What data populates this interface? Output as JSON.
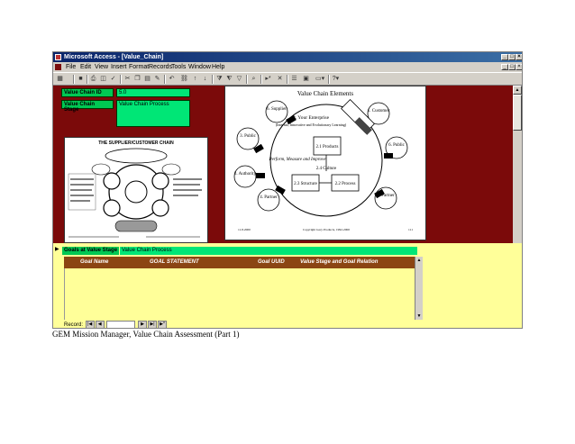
{
  "window": {
    "title": "Microsoft Access - [Value_Chain]",
    "controls": [
      "_",
      "□",
      "×"
    ]
  },
  "menu": {
    "items": [
      "File",
      "Edit",
      "View",
      "Insert",
      "Format",
      "Records",
      "Tools",
      "Window",
      "Help"
    ]
  },
  "toolbar": {
    "icons": [
      "design-view-icon",
      "save-icon",
      "print-icon",
      "print-preview-icon",
      "spelling-icon",
      "cut-icon",
      "copy-icon",
      "paste-icon",
      "format-painter-icon",
      "undo-icon",
      "insert-hyperlink-icon",
      "sort-ascending-icon",
      "sort-descending-icon",
      "filter-by-selection-icon",
      "filter-by-form-icon",
      "apply-filter-icon",
      "find-icon",
      "new-record-icon",
      "delete-record-icon",
      "properties-icon",
      "database-window-icon",
      "new-object-icon",
      "help-icon"
    ]
  },
  "form": {
    "value_chain_id_label": "Value Chain ID",
    "value_chain_id_value": "5.0",
    "value_chain_stage_label": "Value Chain Stage",
    "value_chain_stage_value": "Value Chain Process"
  },
  "diagram1": {
    "title": "THE SUPPLIER/CUSTOMER CHAIN"
  },
  "diagram2": {
    "title": "Value Chain Elements",
    "nodes": {
      "n1": "1. Customer",
      "n2": "2. Your Enterprise",
      "n2_sub": "(Internal, Innovative and Evolutionary Learning)",
      "n3": "3. Public",
      "n4": "4. Partner",
      "n5": "5. Partner",
      "n6": "6. Supplier",
      "n7": "6. Public",
      "n8": "3. Authority",
      "n21": "2.1 Products",
      "n22": "2.2 Process",
      "n23": "2.3 Structure",
      "n24": "2.4 Culture",
      "center": "Perform, Measure and Improve"
    },
    "footer_left": "11.8.2000",
    "footer_center": "Copyright Gary Products, 1992-2000",
    "footer_right": "111"
  },
  "subform": {
    "goals_label": "Goals at Value Stage",
    "goals_value": "Value Chain Process",
    "columns": [
      "Goal Name",
      "GOAL STATEMENT",
      "Goal UUID",
      "Value Stage and Goal Relation"
    ],
    "record_label": "Record:"
  },
  "caption": "GEM Mission Manager, Value Chain Assessment (Part 1)"
}
